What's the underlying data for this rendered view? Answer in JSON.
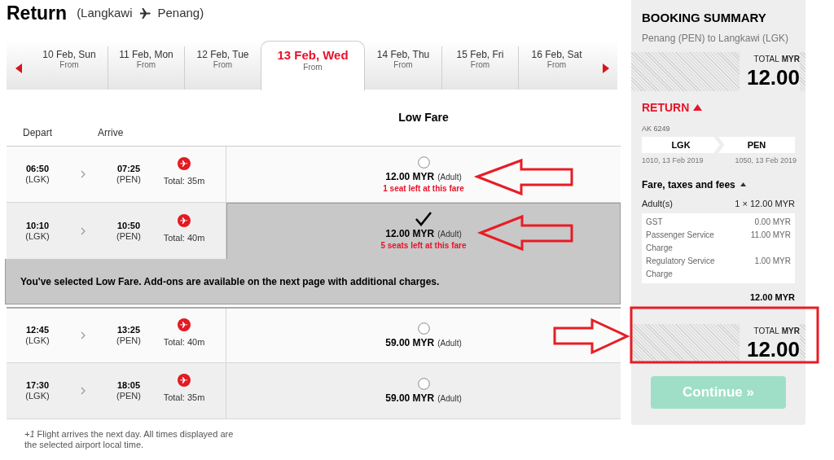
{
  "header": {
    "title": "Return",
    "origin": "(Langkawi",
    "destination": "Penang)"
  },
  "date_tabs": [
    {
      "date": "10 Feb, Sun",
      "from": "From",
      "selected": false
    },
    {
      "date": "11 Feb, Mon",
      "from": "From",
      "selected": false
    },
    {
      "date": "12 Feb, Tue",
      "from": "From",
      "selected": false
    },
    {
      "date": "13 Feb, Wed",
      "from": "From",
      "selected": true
    },
    {
      "date": "14 Feb, Thu",
      "from": "From",
      "selected": false
    },
    {
      "date": "15 Feb, Fri",
      "from": "From",
      "selected": false
    },
    {
      "date": "16 Feb, Sat",
      "from": "From",
      "selected": false
    }
  ],
  "fare_header": "Low Fare",
  "columns": [
    "Depart",
    "Arrive"
  ],
  "flights": [
    {
      "depart_time": "06:50",
      "depart_code": "(LGK)",
      "arrive_time": "07:25",
      "arrive_code": "(PEN)",
      "total": "Total: 35m",
      "price": "12.00 MYR",
      "pax": "(Adult)",
      "seats_left": "1 seat left at this fare",
      "selected": false
    },
    {
      "depart_time": "10:10",
      "depart_code": "(LGK)",
      "arrive_time": "10:50",
      "arrive_code": "(PEN)",
      "total": "Total: 40m",
      "price": "12.00 MYR",
      "pax": "(Adult)",
      "seats_left": "5 seats left at this fare",
      "selected": true
    },
    {
      "depart_time": "12:45",
      "depart_code": "(LGK)",
      "arrive_time": "13:25",
      "arrive_code": "(PEN)",
      "total": "Total: 40m",
      "price": "59.00 MYR",
      "pax": "(Adult)",
      "selected": false
    },
    {
      "depart_time": "17:30",
      "depart_code": "(LGK)",
      "arrive_time": "18:05",
      "arrive_code": "(PEN)",
      "total": "Total: 35m",
      "price": "59.00 MYR",
      "pax": "(Adult)",
      "selected": false
    }
  ],
  "selection_message": "You've selected Low Fare. Add-ons are available on the next page with additional charges.",
  "footnote": "*+1* Flight arrives the next day. All times displayed are the selected airport local time.",
  "summary": {
    "title": "BOOKING SUMMARY",
    "route": "Penang (PEN) to Langkawi (LGK)",
    "total_label": "TOTAL",
    "total_currency": "MYR",
    "total_amount": "12.00",
    "section": "RETURN",
    "section_expanded": true,
    "flight_number": "AK 6249",
    "from_code": "LGK",
    "to_code": "PEN",
    "from_time": "1010, 13 Feb 2019",
    "to_time": "1050, 13 Feb 2019",
    "fees_title": "Fare, taxes and fees",
    "fees_expanded": true,
    "pax_label": "Adult(s)",
    "pax_value": "1 × 12.00 MYR",
    "fees": [
      {
        "label": "GST",
        "value": "0.00 MYR"
      },
      {
        "label": "Passenger Service Charge",
        "value": "11.00 MYR"
      },
      {
        "label": "Regulatory Service Charge",
        "value": "1.00 MYR"
      }
    ],
    "subtotal": "12.00 MYR",
    "bottom_total_label": "TOTAL",
    "bottom_total_currency": "MYR",
    "bottom_total_amount": "12.00",
    "continue": {
      "label": "Continue »",
      "disabled": true
    }
  }
}
